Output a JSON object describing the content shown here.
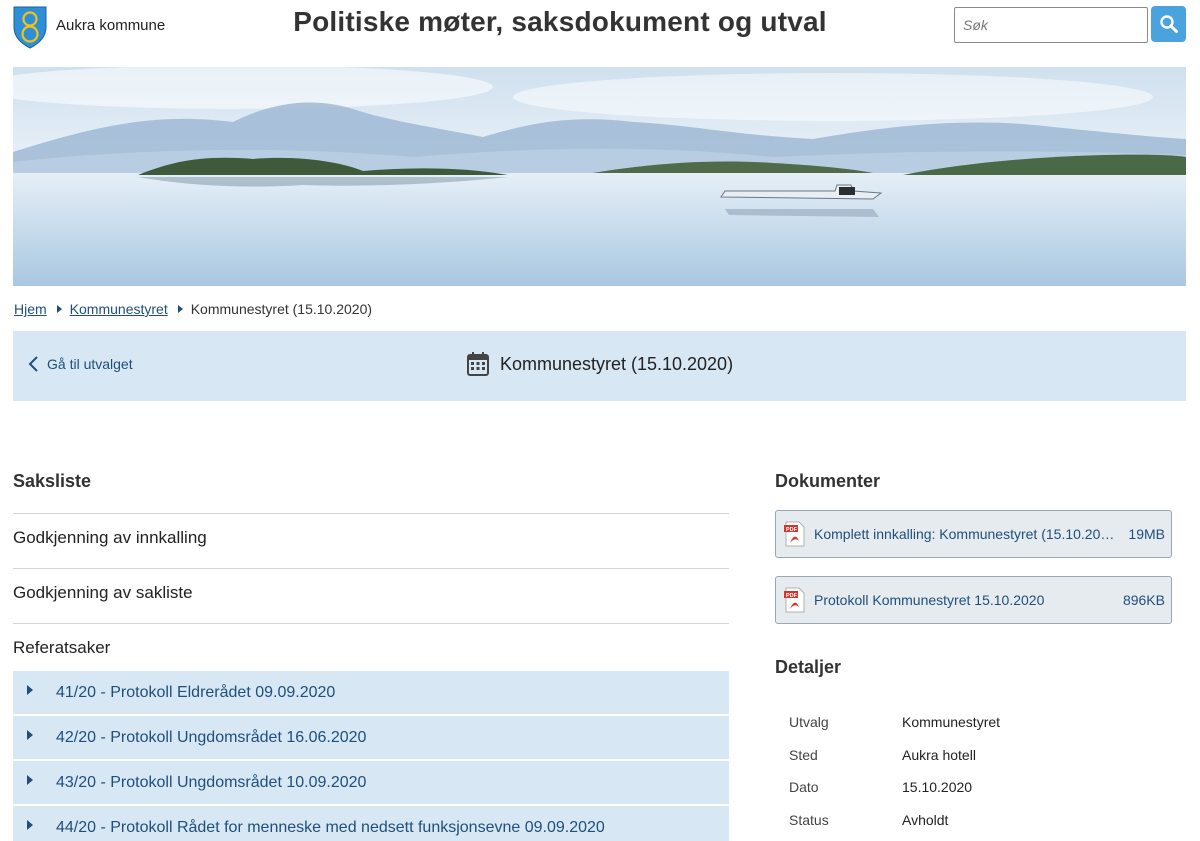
{
  "header": {
    "logo_text": "Aukra kommune",
    "site_title": "Politiske møter, saksdokument og utval",
    "search_placeholder": "Søk",
    "search_icon": "search-icon"
  },
  "colors": {
    "accent": "#4aa3df",
    "panel": "#d7e7f4",
    "link": "#1f4f7a",
    "logo_blue": "#2f8fd6",
    "logo_gold": "#f1c21b"
  },
  "breadcrumb": {
    "items": [
      "Hjem",
      "Kommunestyret"
    ],
    "current": "Kommunestyret (15.10.2020)"
  },
  "meeting": {
    "back_label": "Gå til utvalget",
    "title": "Kommunestyret (15.10.2020)",
    "icon": "calendar-icon"
  },
  "saksliste": {
    "heading": "Saksliste",
    "items": [
      "Godkjenning av innkalling",
      "Godkjenning av sakliste"
    ],
    "referat_heading": "Referatsaker",
    "referat_items": [
      "41/20 - Protokoll Eldrerådet 09.09.2020",
      "42/20 - Protokoll Ungdomsrådet 16.06.2020",
      "43/20 - Protokoll Ungdomsrådet 10.09.2020",
      "44/20 - Protokoll Rådet for menneske med nedsett funksjonsevne 09.09.2020"
    ]
  },
  "dokumenter": {
    "heading": "Dokumenter",
    "items": [
      {
        "name": "Komplett innkalling: Kommunestyret (15.10.2020)",
        "size": "19MB"
      },
      {
        "name": "Protokoll Kommunestyret 15.10.2020",
        "size": "896KB"
      }
    ]
  },
  "detaljer": {
    "heading": "Detaljer",
    "rows": [
      {
        "label": "Utvalg",
        "value": "Kommunestyret"
      },
      {
        "label": "Sted",
        "value": "Aukra hotell"
      },
      {
        "label": "Dato",
        "value": "15.10.2020"
      },
      {
        "label": "Status",
        "value": "Avholdt"
      }
    ]
  }
}
